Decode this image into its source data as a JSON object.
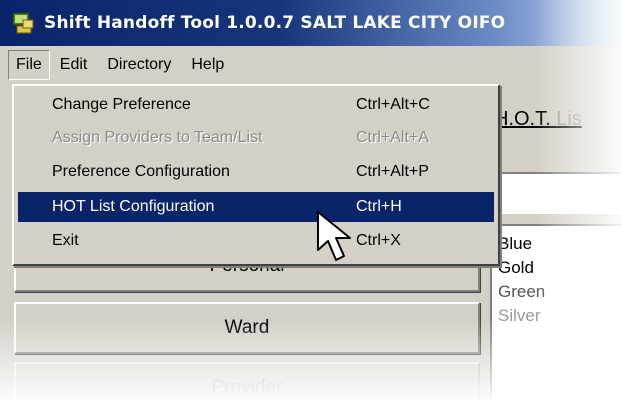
{
  "window": {
    "title": "Shift Handoff Tool 1.0.0.7  SALT LAKE CITY OIFO",
    "icon": "app-computer-icon"
  },
  "menubar": {
    "items": [
      "File",
      "Edit",
      "Directory",
      "Help"
    ],
    "active": "File"
  },
  "file_menu": {
    "items": [
      {
        "label": "Change Preference",
        "shortcut": "Ctrl+Alt+C",
        "enabled": true
      },
      {
        "label": "Assign Providers to Team/List",
        "shortcut": "Ctrl+Alt+A",
        "enabled": false
      },
      {
        "label": "Preference Configuration",
        "shortcut": "Ctrl+Alt+P",
        "enabled": true
      },
      {
        "label": "HOT List Configuration",
        "shortcut": "Ctrl+H",
        "enabled": true,
        "highlighted": true
      },
      {
        "label": "Exit",
        "shortcut": "Ctrl+X",
        "enabled": true
      }
    ]
  },
  "hot_list": {
    "label_main": "H.O.T.",
    "label_faded": "Lis"
  },
  "buttons": {
    "personal": "Personal",
    "ward": "Ward",
    "provider": "Provider"
  },
  "list": {
    "items": [
      "Blue",
      "Gold",
      "Green",
      "Silver"
    ]
  },
  "colors": {
    "highlight": "#0a246a",
    "face": "#d4d0c8"
  }
}
